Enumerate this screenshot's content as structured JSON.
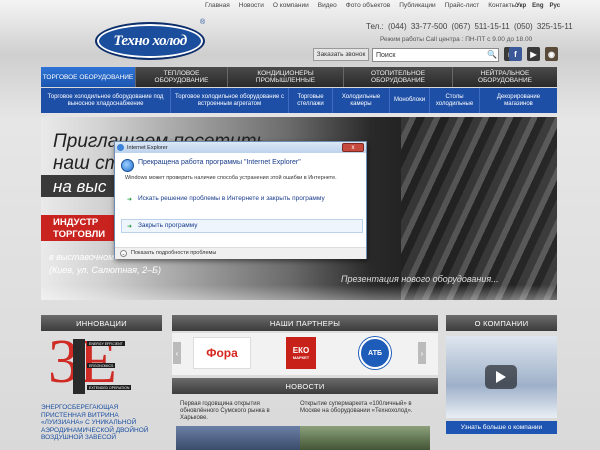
{
  "top_nav": [
    "Главная",
    "Новости",
    "О компании",
    "Видео",
    "Фото объектов",
    "Публикации",
    "Прайс-лист",
    "Контакты"
  ],
  "languages": [
    "Укр",
    "Eng",
    "Рус"
  ],
  "logo": {
    "text": "Техно холод",
    "reg": "®"
  },
  "header": {
    "phones": "Тел.: (044) 33-77-500   (067) 511-15-11   (050) 325-15-11",
    "hours": "Режим работы Call центра : ПН-ПТ с 9.00 до 18.00",
    "callback_label": "Заказать звонок",
    "search_value": "Поиск",
    "socials": [
      "vk-icon",
      "facebook-icon",
      "youtube-icon",
      "instagram-icon"
    ]
  },
  "main_menu": [
    "ТОРГОВОЕ ОБОРУДОВАНИЕ",
    "ТЕПЛОВОЕ ОБОРУДОВАНИЕ",
    "КОНДИЦИОНЕРЫ ПРОМЫШЛЕННЫЕ",
    "ОТОПИТЕЛЬНОЕ ОБОРУДОВАНИЕ",
    "НЕЙТРАЛЬНОЕ ОБОРУДОВАНИЕ"
  ],
  "sub_menu": [
    "Торговое холодильное оборудование под выносное хладоснабжение",
    "Торговое холодильное оборудование с встроенным агрегатом",
    "Торговые стеллажи",
    "Холодильные камеры",
    "Моноблоки",
    "Столы холодильные",
    "Декорирование магазинов"
  ],
  "banner": {
    "line1": "Приглашаем посетить",
    "line2": "наш ст",
    "line3": "на выс",
    "red1": "ИНДУСТР",
    "red2": "ТОРГОВЛИ",
    "addr1": "в выставочном",
    "addr2": "(Киев, ул. Салютная, 2–Б)",
    "caption": "Презентация нового оборудования..."
  },
  "dialog": {
    "title": "Internet Explorer",
    "close": "x",
    "heading": "Прекращена работа программы \"Internet Explorer\"",
    "subtext": "Windows может проверить наличие способа устранения этой ошибки в Интернете.",
    "option1": "Искать решение проблемы в Интернете и закрыть программу",
    "option2": "Закрыть программу",
    "details": "Показать подробности проблемы"
  },
  "sections": {
    "innovations": "ИННОВАЦИИ",
    "partners": "НАШИ ПАРТНЕРЫ",
    "about": "О КОМПАНИИ",
    "news": "НОВОСТИ"
  },
  "innovations": {
    "big": "3E",
    "tags": [
      "ENERGY EFFICIENT",
      "ERGONOMICS",
      "EXTENDED OPERATION"
    ],
    "vertical": "TECHNOLOGIES",
    "text": "ЭНЕРГОСБЕРЕГАЮЩАЯ ПРИСТЕННАЯ ВИТРИНА «ЛУИЗИАНА» С УНИКАЛЬНОЙ АЭРОДИНАМИЧЕСКОЙ ДВОЙНОЙ ВОЗДУШНОЙ ЗАВЕСОЙ"
  },
  "partners": {
    "fora": "Фора",
    "eko": "ЕКО",
    "eko_sub": "МАРКЕТ",
    "atb": "АТБ"
  },
  "news": {
    "item1": "Первая годовщина открытия обновлённого Сумского рынка в Харькове.",
    "item2": "Открытие супермаркета «100личный» в Москве на оборудовании «Технохолод»."
  },
  "about": {
    "button": "Узнать больше о компании"
  }
}
